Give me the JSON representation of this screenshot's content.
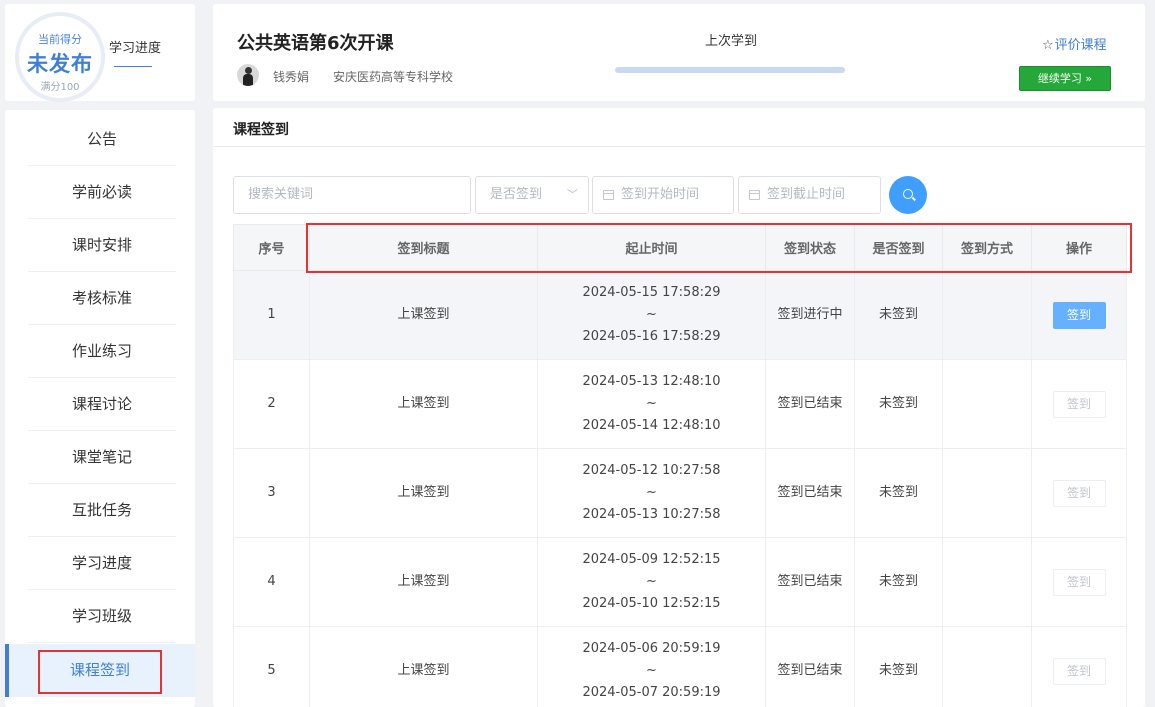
{
  "score": {
    "label": "当前得分",
    "value": "未发布",
    "full": "满分100",
    "progress_link": "学习进度"
  },
  "menu": {
    "items": [
      {
        "label": "公告"
      },
      {
        "label": "学前必读"
      },
      {
        "label": "课时安排"
      },
      {
        "label": "考核标准"
      },
      {
        "label": "作业练习"
      },
      {
        "label": "课程讨论"
      },
      {
        "label": "课堂笔记"
      },
      {
        "label": "互批任务"
      },
      {
        "label": "学习进度"
      },
      {
        "label": "学习班级"
      },
      {
        "label": "课程签到"
      }
    ],
    "active_index": 10
  },
  "course": {
    "title": "公共英语第6次开课",
    "teacher": "钱秀娟",
    "school": "安庆医药高等专科学校",
    "last_study_label": "上次学到",
    "rate_label": "评价课程",
    "continue_label": "继续学习 »"
  },
  "section": {
    "title": "课程签到"
  },
  "filters": {
    "search_placeholder": "搜索关键词",
    "status_placeholder": "是否签到",
    "start_placeholder": "签到开始时间",
    "end_placeholder": "签到截止时间"
  },
  "table": {
    "columns": [
      "序号",
      "签到标题",
      "起止时间",
      "签到状态",
      "是否签到",
      "签到方式",
      "操作"
    ],
    "rows": [
      {
        "no": "1",
        "title": "上课签到",
        "start": "2024-05-15 17:58:29",
        "sep": "~",
        "end": "2024-05-16 17:58:29",
        "status": "签到进行中",
        "signed": "未签到",
        "method": "",
        "action": "签到"
      },
      {
        "no": "2",
        "title": "上课签到",
        "start": "2024-05-13 12:48:10",
        "sep": "~",
        "end": "2024-05-14 12:48:10",
        "status": "签到已结束",
        "signed": "未签到",
        "method": "",
        "action": "签到"
      },
      {
        "no": "3",
        "title": "上课签到",
        "start": "2024-05-12 10:27:58",
        "sep": "~",
        "end": "2024-05-13 10:27:58",
        "status": "签到已结束",
        "signed": "未签到",
        "method": "",
        "action": "签到"
      },
      {
        "no": "4",
        "title": "上课签到",
        "start": "2024-05-09 12:52:15",
        "sep": "~",
        "end": "2024-05-10 12:52:15",
        "status": "签到已结束",
        "signed": "未签到",
        "method": "",
        "action": "签到"
      },
      {
        "no": "5",
        "title": "上课签到",
        "start": "2024-05-06 20:59:19",
        "sep": "~",
        "end": "2024-05-07 20:59:19",
        "status": "签到已结束",
        "signed": "未签到",
        "method": "",
        "action": "签到"
      }
    ]
  },
  "colors": {
    "accent": "#3f7fd6",
    "primary_button": "#66b1ff",
    "continue_button": "#24a83a",
    "highlight_box": "#e23434"
  }
}
